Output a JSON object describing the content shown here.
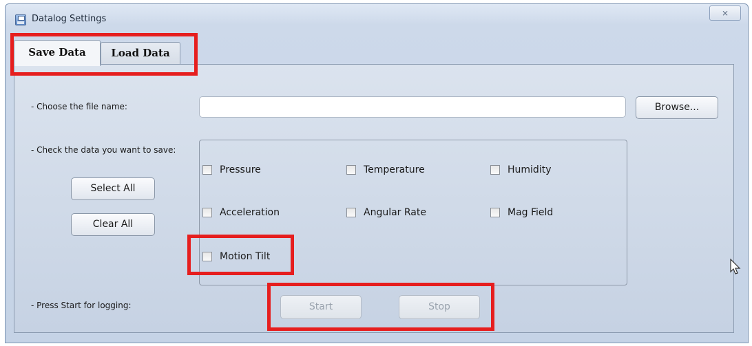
{
  "window": {
    "title": "Datalog Settings",
    "close_glyph": "⨯",
    "icon": "save-disk-icon"
  },
  "tabs": [
    {
      "label": "Save Data",
      "active": true
    },
    {
      "label": "Load Data",
      "active": false
    }
  ],
  "file": {
    "label": "- Choose the file name:",
    "value": "",
    "browse_label": "Browse..."
  },
  "check": {
    "label": "- Check the data you want to save:",
    "select_all": "Select All",
    "clear_all": "Clear All",
    "items": [
      {
        "label": "Pressure",
        "checked": false
      },
      {
        "label": "Temperature",
        "checked": false
      },
      {
        "label": "Humidity",
        "checked": false
      },
      {
        "label": "Acceleration",
        "checked": false
      },
      {
        "label": "Angular Rate",
        "checked": false
      },
      {
        "label": "Mag Field",
        "checked": false
      },
      {
        "label": "Motion Tilt",
        "checked": false
      }
    ]
  },
  "logging": {
    "label": "- Press Start for logging:",
    "start": "Start",
    "stop": "Stop"
  },
  "colors": {
    "highlight": "#e61e1e",
    "disabled_text": "#9aa3ae"
  }
}
